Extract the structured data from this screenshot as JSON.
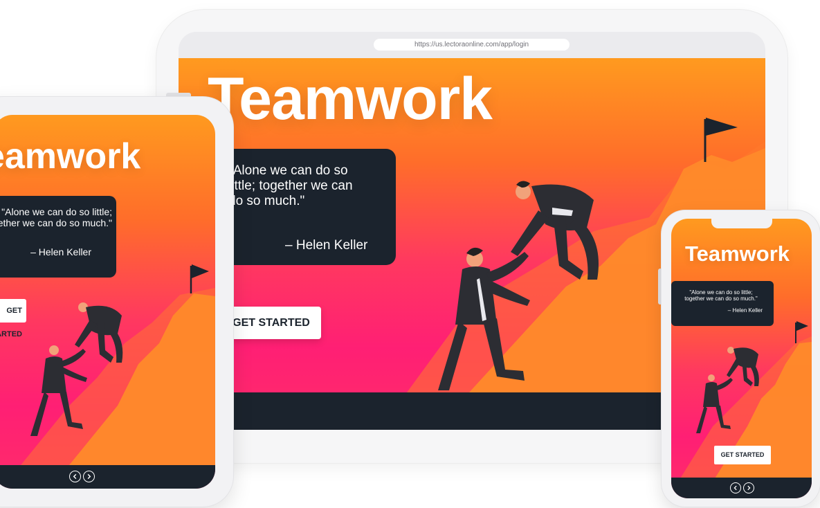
{
  "desktop": {
    "url": "https://us.lectoraonline.com/app/login",
    "title": "Teamwork",
    "quote_lines": [
      "\"Alone we can do so",
      "little; together we can",
      "do so much.\""
    ],
    "author": "– Helen Keller",
    "button": "GET STARTED"
  },
  "tablet": {
    "title": "Teamwork",
    "quote_lines": [
      "\"Alone we can do so little;",
      "together we can do so much.\""
    ],
    "author": "– Helen Keller",
    "button": "GET STARTED",
    "nav": {
      "prev_icon": "chevron-left-icon",
      "next_icon": "chevron-right-icon"
    }
  },
  "phone": {
    "title": "Teamwork",
    "quote_lines": [
      "\"Alone we can do so little;",
      "together we can do so much.\""
    ],
    "author": "– Helen Keller",
    "button": "GET STARTED",
    "nav": {
      "prev_icon": "chevron-left-icon",
      "next_icon": "chevron-right-icon"
    }
  },
  "colors": {
    "dark": "#1b232d",
    "gradient_top": "#ff9a1f",
    "gradient_bottom": "#ff1f74",
    "mountain": "#ff8a2a"
  }
}
